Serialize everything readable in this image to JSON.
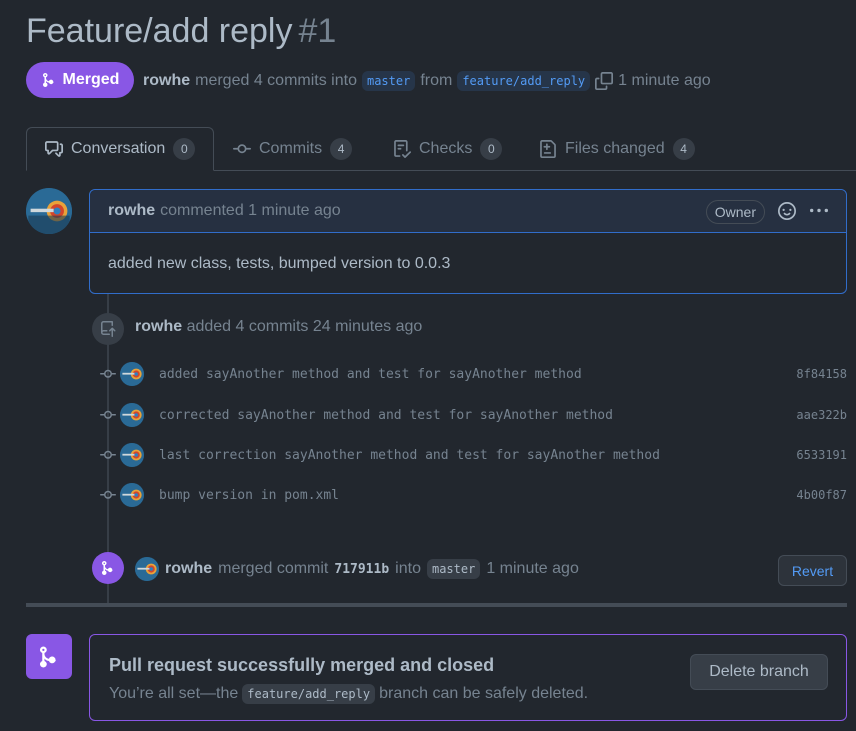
{
  "header": {
    "title": "Feature/add reply",
    "number": "#1",
    "state_label": "Merged",
    "author": "rowhe",
    "merged_text": "merged 4 commits into",
    "base_branch": "master",
    "from_text": "from",
    "head_branch": "feature/add_reply",
    "time": "1 minute ago"
  },
  "tabs": [
    {
      "label": "Conversation",
      "count": "0"
    },
    {
      "label": "Commits",
      "count": "4"
    },
    {
      "label": "Checks",
      "count": "0"
    },
    {
      "label": "Files changed",
      "count": "4"
    }
  ],
  "comment": {
    "author": "rowhe",
    "action": "commented 1 minute ago",
    "badge": "Owner",
    "body": "added new class, tests, bumped version to 0.0.3"
  },
  "commits_event": {
    "author": "rowhe",
    "text": "added 4 commits 24 minutes ago"
  },
  "commits": [
    {
      "message": "added sayAnother method and test for sayAnother method",
      "sha": "8f84158"
    },
    {
      "message": "corrected sayAnother method and test for sayAnother method",
      "sha": "aae322b"
    },
    {
      "message": "last correction sayAnother method and test for sayAnother method",
      "sha": "6533191"
    },
    {
      "message": "bump version in pom.xml",
      "sha": "4b00f87"
    }
  ],
  "merge_event": {
    "author": "rowhe",
    "text": "merged commit",
    "sha": "717911b",
    "into_text": "into",
    "branch": "master",
    "time": "1 minute ago",
    "revert_label": "Revert"
  },
  "merged_box": {
    "title": "Pull request successfully merged and closed",
    "sub_before": "You’re all set—the",
    "branch": "feature/add_reply",
    "sub_after": "branch can be safely deleted.",
    "delete_label": "Delete branch"
  },
  "colors": {
    "background": "#22272e",
    "merged_purple": "#8957e5",
    "link_blue": "#539bf5",
    "comment_border": "#316dca"
  }
}
